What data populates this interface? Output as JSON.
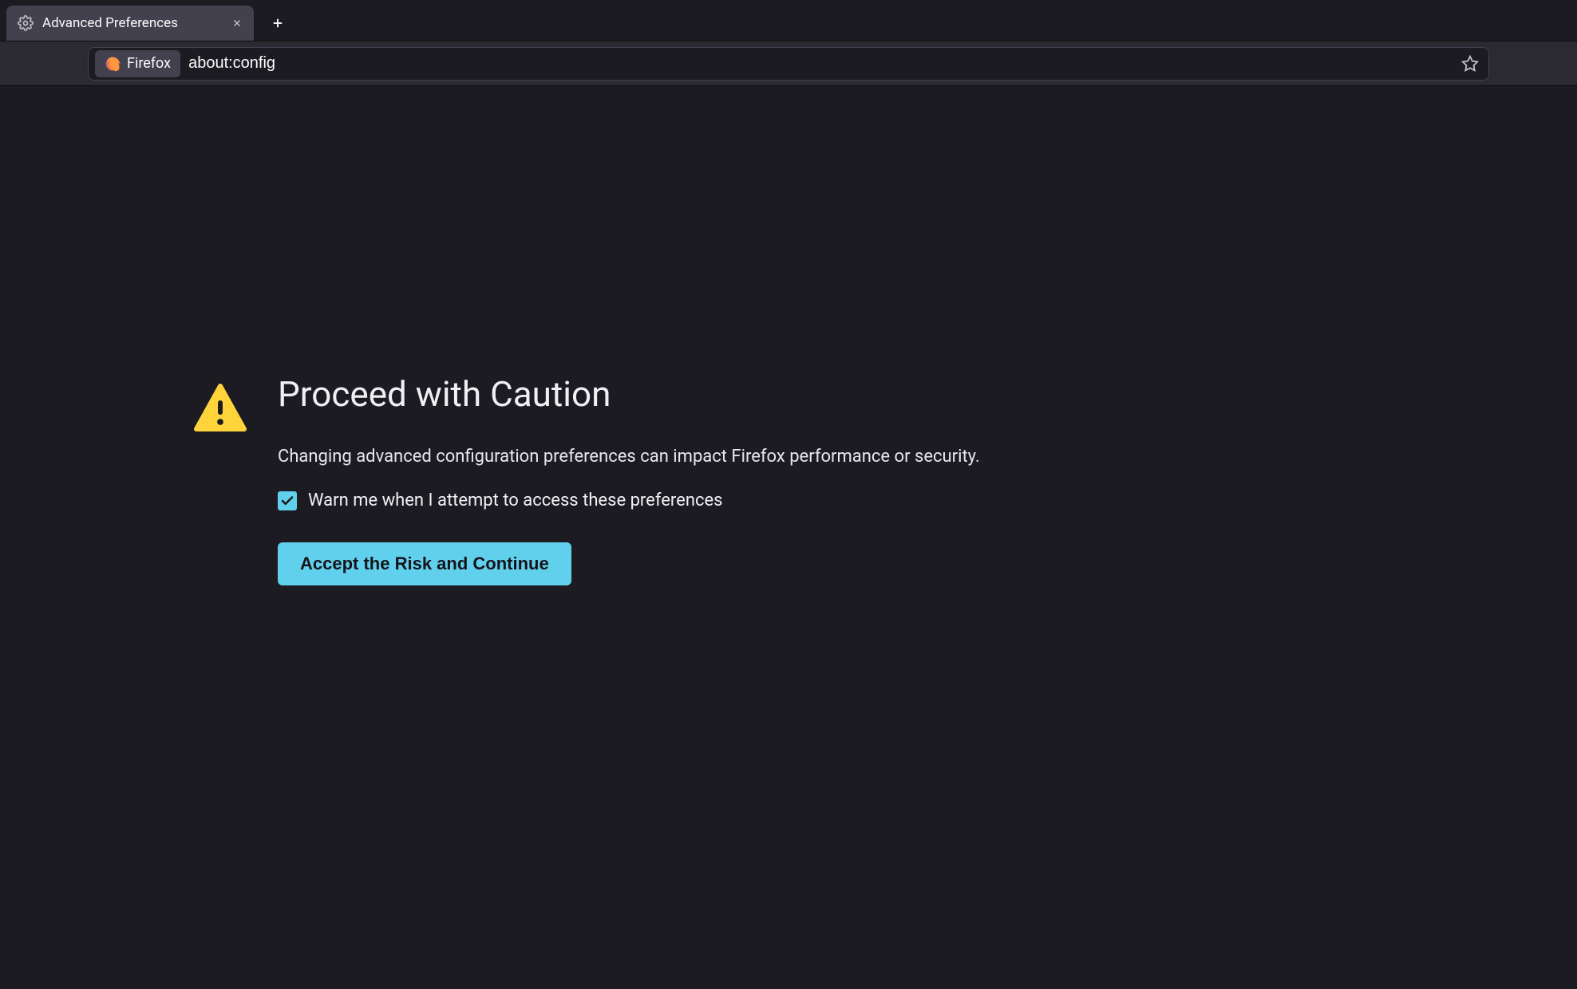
{
  "tab": {
    "title": "Advanced Preferences"
  },
  "identity": {
    "label": "Firefox"
  },
  "url": {
    "value": "about:config"
  },
  "warning": {
    "title": "Proceed with Caution",
    "description": "Changing advanced configuration preferences can impact Firefox performance or security.",
    "checkbox_label": "Warn me when I attempt to access these preferences",
    "checkbox_checked": true,
    "button_label": "Accept the Risk and Continue"
  }
}
